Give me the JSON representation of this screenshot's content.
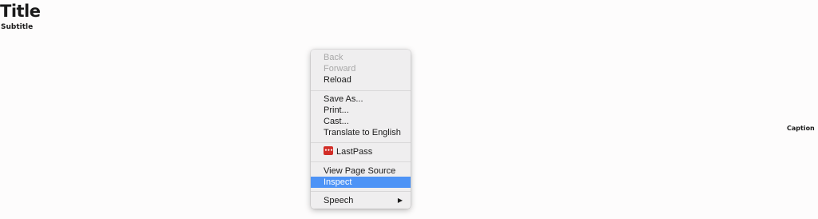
{
  "page": {
    "title": "Title",
    "subtitle": "Subtitle",
    "caption": "Caption"
  },
  "context_menu": {
    "items": [
      {
        "label": "Back",
        "enabled": false
      },
      {
        "label": "Forward",
        "enabled": false
      },
      {
        "label": "Reload",
        "enabled": true
      },
      {
        "label": "Save As...",
        "enabled": true
      },
      {
        "label": "Print...",
        "enabled": true
      },
      {
        "label": "Cast...",
        "enabled": true
      },
      {
        "label": "Translate to English",
        "enabled": true
      },
      {
        "label": "LastPass",
        "enabled": true,
        "icon": "lastpass-icon"
      },
      {
        "label": "View Page Source",
        "enabled": true
      },
      {
        "label": "Inspect",
        "enabled": true,
        "highlighted": true
      },
      {
        "label": "Speech",
        "enabled": true,
        "submenu": true,
        "icon": "chevron-right-icon"
      }
    ],
    "lastpass_icon_text": "•••",
    "colors": {
      "highlight": "#4d93f6",
      "disabled_text": "#a9a9a9",
      "lastpass_red": "#d22d27"
    }
  }
}
